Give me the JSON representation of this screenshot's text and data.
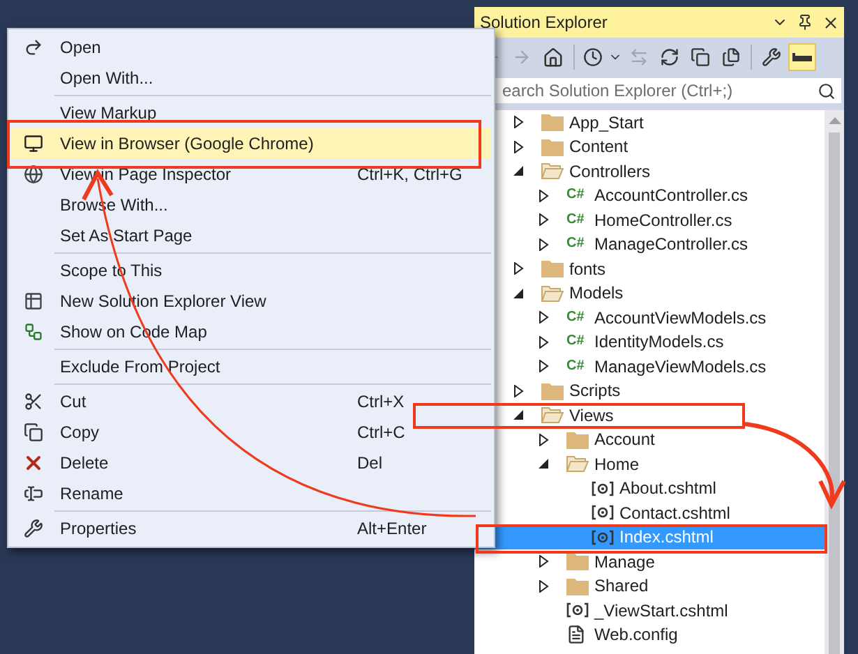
{
  "context_menu": {
    "groups": [
      [
        {
          "label": "Open",
          "kind": "open",
          "selected": false
        },
        {
          "label": "Open With...",
          "selected": false
        }
      ],
      [
        {
          "label": "View Markup",
          "selected": false
        },
        {
          "label": "View in Browser (Google Chrome)",
          "kind": "browser",
          "selected": true
        },
        {
          "label": "View in Page Inspector",
          "kind": "inspector",
          "shortcut": "Ctrl+K, Ctrl+G",
          "selected": false
        },
        {
          "label": "Browse With...",
          "selected": false
        },
        {
          "label": "Set As Start Page",
          "selected": false
        }
      ],
      [
        {
          "label": "Scope to This",
          "selected": false
        },
        {
          "label": "New Solution Explorer View",
          "kind": "new-view",
          "selected": false
        },
        {
          "label": "Show on Code Map",
          "kind": "code-map",
          "selected": false
        }
      ],
      [
        {
          "label": "Exclude From Project",
          "selected": false
        }
      ],
      [
        {
          "label": "Cut",
          "kind": "cut",
          "shortcut": "Ctrl+X",
          "selected": false
        },
        {
          "label": "Copy",
          "kind": "copy",
          "shortcut": "Ctrl+C",
          "selected": false
        },
        {
          "label": "Delete",
          "kind": "delete",
          "shortcut": "Del",
          "selected": false
        },
        {
          "label": "Rename",
          "kind": "rename",
          "selected": false
        }
      ],
      [
        {
          "label": "Properties",
          "kind": "properties",
          "shortcut": "Alt+Enter",
          "selected": false
        }
      ]
    ]
  },
  "solution_explorer": {
    "title": "Solution Explorer",
    "search": {
      "placeholder": "earch Solution Explorer (Ctrl+;)"
    },
    "tree": [
      {
        "label": "App_Start",
        "kind": "folder",
        "expanded": false,
        "selected": false
      },
      {
        "label": "Content",
        "kind": "folder",
        "expanded": false,
        "selected": false
      },
      {
        "label": "Controllers",
        "kind": "folder",
        "expanded": true,
        "selected": false,
        "children": [
          {
            "label": "AccountController.cs",
            "kind": "cs",
            "icon_text": "C#",
            "expanded": false,
            "selected": false
          },
          {
            "label": "HomeController.cs",
            "kind": "cs",
            "icon_text": "C#",
            "expanded": false,
            "selected": false
          },
          {
            "label": "ManageController.cs",
            "kind": "cs",
            "icon_text": "C#",
            "expanded": false,
            "selected": false
          }
        ]
      },
      {
        "label": "fonts",
        "kind": "folder",
        "expanded": false,
        "selected": false
      },
      {
        "label": "Models",
        "kind": "folder",
        "expanded": true,
        "selected": false,
        "children": [
          {
            "label": "AccountViewModels.cs",
            "kind": "cs",
            "icon_text": "C#",
            "expanded": false,
            "selected": false
          },
          {
            "label": "IdentityModels.cs",
            "kind": "cs",
            "icon_text": "C#",
            "expanded": false,
            "selected": false
          },
          {
            "label": "ManageViewModels.cs",
            "kind": "cs",
            "icon_text": "C#",
            "expanded": false,
            "selected": false
          }
        ]
      },
      {
        "label": "Scripts",
        "kind": "folder",
        "expanded": false,
        "selected": false
      },
      {
        "label": "Views",
        "kind": "folder",
        "expanded": true,
        "selected": false,
        "children": [
          {
            "label": "Account",
            "kind": "folder",
            "expanded": false,
            "selected": false
          },
          {
            "label": "Home",
            "kind": "folder",
            "expanded": true,
            "selected": false,
            "children": [
              {
                "label": "About.cshtml",
                "kind": "cshtml",
                "selected": false
              },
              {
                "label": "Contact.cshtml",
                "kind": "cshtml",
                "selected": false
              },
              {
                "label": "Index.cshtml",
                "kind": "cshtml",
                "selected": true
              }
            ]
          },
          {
            "label": "Manage",
            "kind": "folder",
            "expanded": false,
            "selected": false
          },
          {
            "label": "Shared",
            "kind": "folder",
            "expanded": false,
            "selected": false
          },
          {
            "label": "_ViewStart.cshtml",
            "kind": "cshtml",
            "selected": false
          },
          {
            "label": "Web.config",
            "kind": "config",
            "selected": false
          }
        ]
      }
    ]
  }
}
